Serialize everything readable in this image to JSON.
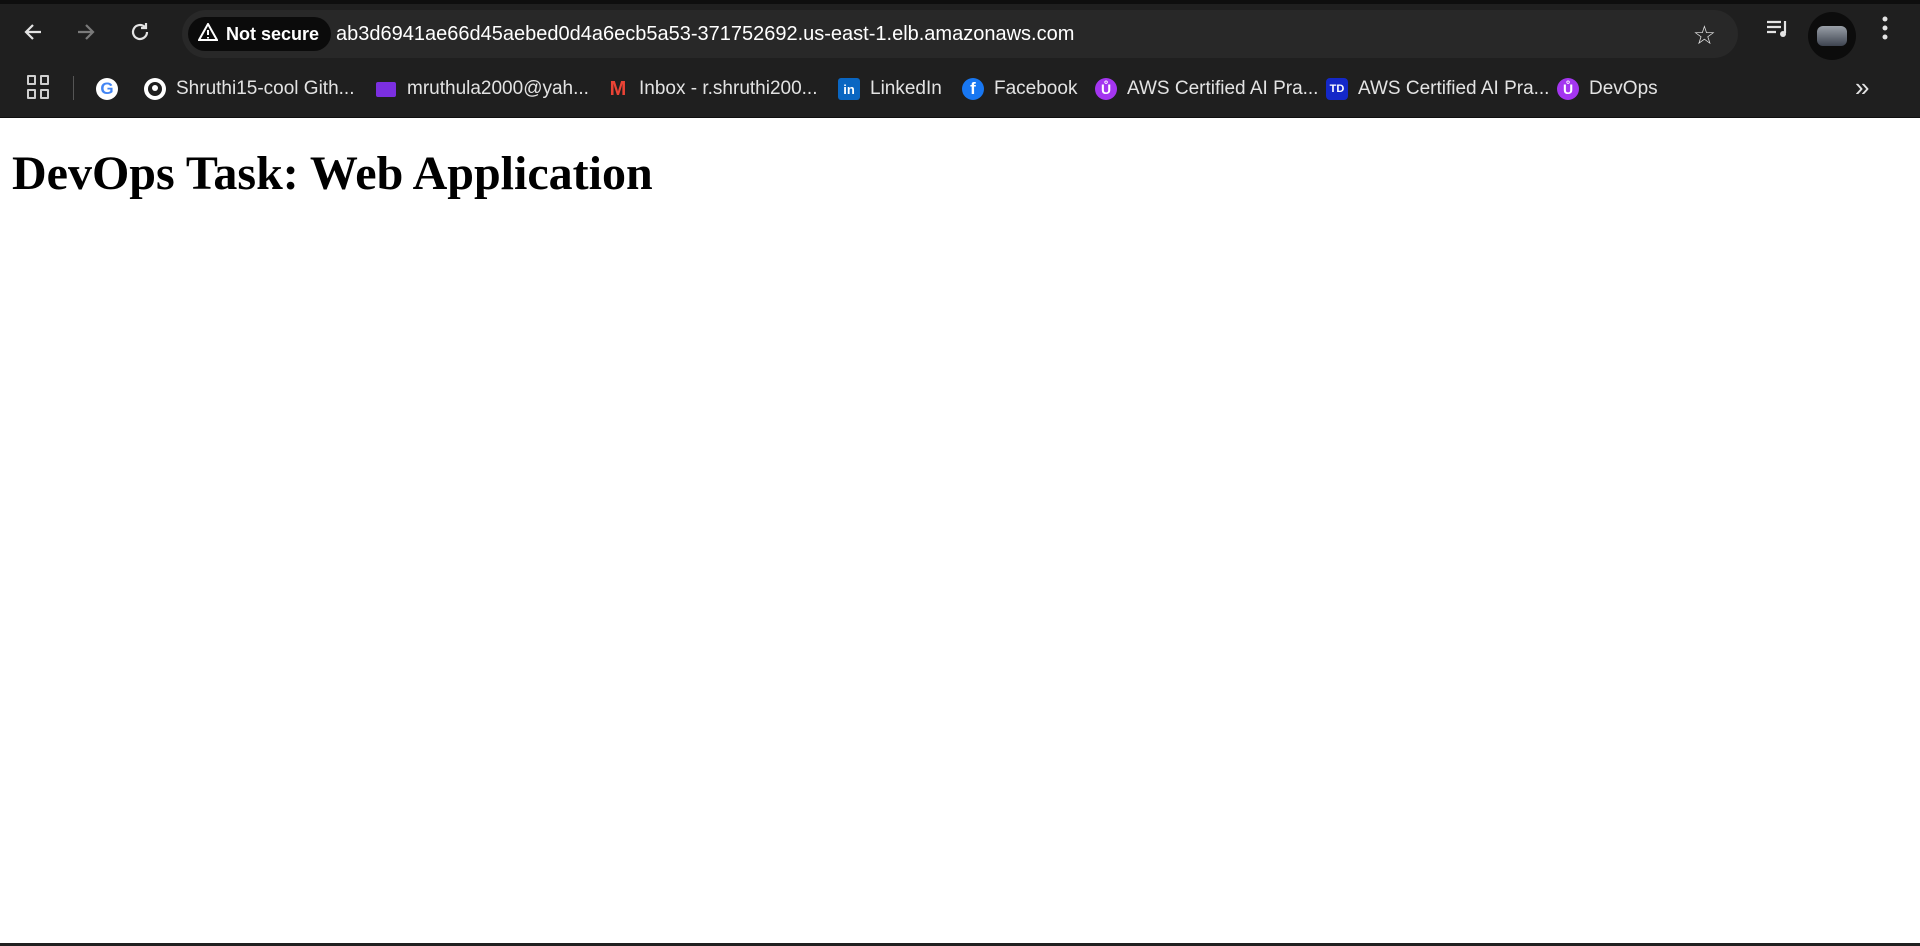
{
  "browser": {
    "security_label": "Not secure",
    "url": "ab3d6941ae66d45aebed0d4a6ecb5a53-371752692.us-east-1.elb.amazonaws.com",
    "icons": {
      "back": "back-arrow-icon",
      "forward": "forward-arrow-icon",
      "reload": "reload-icon",
      "bookmark": "star-icon",
      "media": "media-controls-icon",
      "menu": "more-vert-icon"
    }
  },
  "bookmarks": {
    "items": [
      {
        "label": "",
        "icon": "google-icon"
      },
      {
        "label": "Shruthi15-cool Gith...",
        "icon": "github-icon"
      },
      {
        "label": "mruthula2000@yah...",
        "icon": "yahoo-mail-icon"
      },
      {
        "label": "Inbox - r.shruthi200...",
        "icon": "gmail-icon"
      },
      {
        "label": "LinkedIn",
        "icon": "linkedin-icon"
      },
      {
        "label": "Facebook",
        "icon": "facebook-icon"
      },
      {
        "label": "AWS Certified AI Pra...",
        "icon": "udemy-icon"
      },
      {
        "label": "AWS Certified AI Pra...",
        "icon": "tutorials-dojo-icon"
      },
      {
        "label": "DevOps",
        "icon": "udemy-icon"
      }
    ]
  },
  "page": {
    "heading": "DevOps Task: Web Application"
  },
  "colors": {
    "toolbar_bg": "#1f1f1f",
    "omnibox_bg": "#282828",
    "page_bg": "#ffffff"
  }
}
